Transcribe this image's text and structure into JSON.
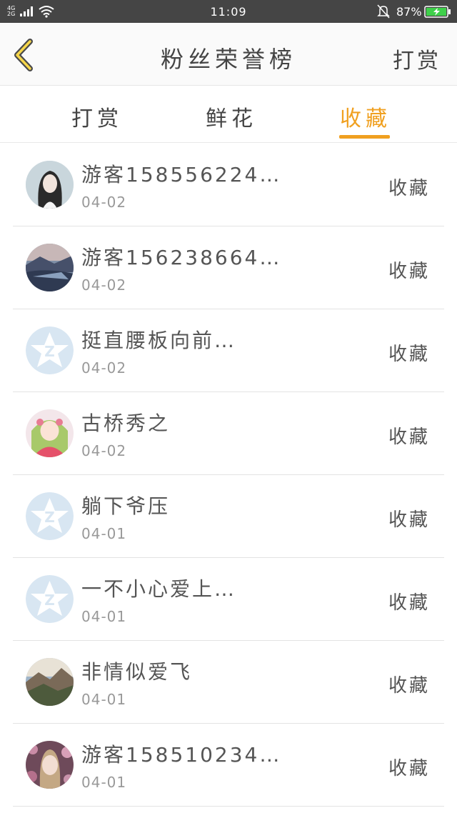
{
  "status_bar": {
    "network_top": "4G",
    "network_bottom": "2G",
    "time": "11:09",
    "battery": "87%"
  },
  "nav": {
    "title": "粉丝荣誉榜",
    "right_action": "打赏",
    "back_icon": "chevron-left-icon"
  },
  "tabs": [
    {
      "label": "打赏",
      "active": false
    },
    {
      "label": "鲜花",
      "active": false
    },
    {
      "label": "收藏",
      "active": true
    }
  ],
  "colors": {
    "accent": "#f0a020",
    "status_bar": "#454545",
    "divider": "#e3e3e3"
  },
  "items": [
    {
      "name": "游客158556224…",
      "date": "04-02",
      "action": "收藏",
      "avatar": "girl-photo"
    },
    {
      "name": "游客156238664…",
      "date": "04-02",
      "action": "收藏",
      "avatar": "lake-photo"
    },
    {
      "name": "挺直腰板向前…",
      "date": "04-02",
      "action": "收藏",
      "avatar": "default-star"
    },
    {
      "name": "古桥秀之",
      "date": "04-02",
      "action": "收藏",
      "avatar": "anime"
    },
    {
      "name": "躺下爷压",
      "date": "04-01",
      "action": "收藏",
      "avatar": "default-star"
    },
    {
      "name": "一不小心爱上…",
      "date": "04-01",
      "action": "收藏",
      "avatar": "default-star"
    },
    {
      "name": "非情似爱飞",
      "date": "04-01",
      "action": "收藏",
      "avatar": "mountain-photo"
    },
    {
      "name": "游客158510234…",
      "date": "04-01",
      "action": "收藏",
      "avatar": "woman-flowers"
    }
  ]
}
